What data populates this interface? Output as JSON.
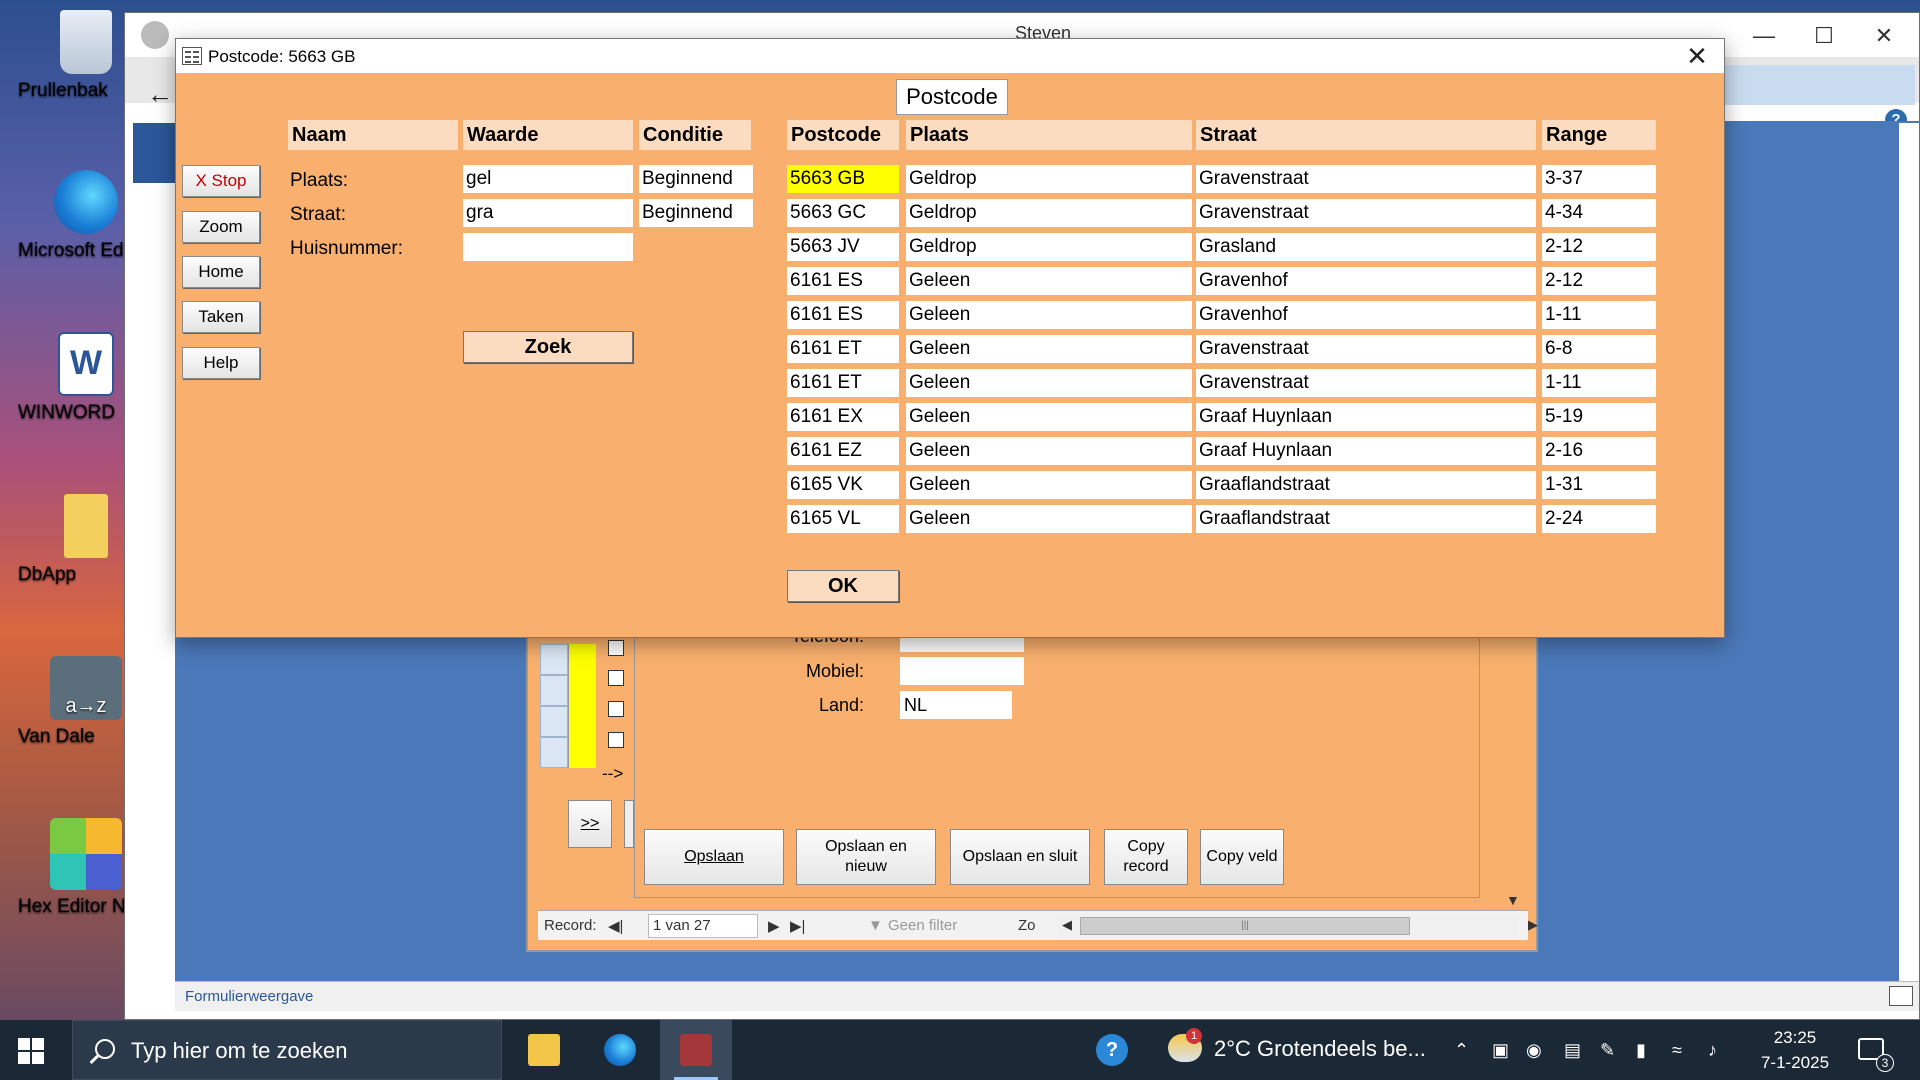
{
  "desktop": {
    "icons": [
      {
        "label": "Prullenbak"
      },
      {
        "label": "Microsoft Ed"
      },
      {
        "label": "WINWORD"
      },
      {
        "label": "DbApp"
      },
      {
        "label": "Van Dale"
      },
      {
        "label": "Hex Editor N"
      }
    ]
  },
  "access": {
    "title": "Steven",
    "status": "Formulierweergave",
    "bg_form": {
      "labels": {
        "telefoon": "Telefoon:",
        "mobiel": "Mobiel:",
        "land": "Land:"
      },
      "land_value": "NL",
      "arrow_text": "-->",
      "next_button": ">>",
      "buttons": {
        "opslaan": "Opslaan",
        "opslaan_nieuw": "Opslaan en nieuw",
        "opslaan_sluit": "Opslaan en sluit",
        "copy_record": "Copy record",
        "copy_veld": "Copy veld"
      }
    },
    "navbar": {
      "record_label": "Record:",
      "record_value": "1 van 27",
      "filter": "Geen filter",
      "search": "Zo"
    }
  },
  "dialog": {
    "title": "Postcode: 5663 GB",
    "side_buttons": {
      "stop": "X Stop",
      "zoom": "Zoom",
      "home": "Home",
      "taken": "Taken",
      "help": "Help"
    },
    "criteria": {
      "headers": {
        "naam": "Naam",
        "waarde": "Waarde",
        "conditie": "Conditie"
      },
      "rows": [
        {
          "label": "Plaats:",
          "value": "gel",
          "condition": "Beginnend"
        },
        {
          "label": "Straat:",
          "value": "gra",
          "condition": "Beginnend"
        },
        {
          "label": "Huisnummer:",
          "value": "",
          "condition": ""
        }
      ],
      "search_button": "Zoek"
    },
    "results": {
      "title": "Postcode",
      "headers": {
        "postcode": "Postcode",
        "plaats": "Plaats",
        "straat": "Straat",
        "range": "Range"
      },
      "rows": [
        {
          "postcode": "5663 GB",
          "plaats": "Geldrop",
          "straat": "Gravenstraat",
          "range": "3-37"
        },
        {
          "postcode": "5663 GC",
          "plaats": "Geldrop",
          "straat": "Gravenstraat",
          "range": "4-34"
        },
        {
          "postcode": "5663 JV",
          "plaats": "Geldrop",
          "straat": "Grasland",
          "range": "2-12"
        },
        {
          "postcode": "6161 ES",
          "plaats": "Geleen",
          "straat": "Gravenhof",
          "range": "2-12"
        },
        {
          "postcode": "6161 ES",
          "plaats": "Geleen",
          "straat": "Gravenhof",
          "range": "1-11"
        },
        {
          "postcode": "6161 ET",
          "plaats": "Geleen",
          "straat": "Gravenstraat",
          "range": "6-8"
        },
        {
          "postcode": "6161 ET",
          "plaats": "Geleen",
          "straat": "Gravenstraat",
          "range": "1-11"
        },
        {
          "postcode": "6161 EX",
          "plaats": "Geleen",
          "straat": "Graaf Huynlaan",
          "range": "5-19"
        },
        {
          "postcode": "6161 EZ",
          "plaats": "Geleen",
          "straat": "Graaf Huynlaan",
          "range": "2-16"
        },
        {
          "postcode": "6165 VK",
          "plaats": "Geleen",
          "straat": "Graaflandstraat",
          "range": "1-31"
        },
        {
          "postcode": "6165 VL",
          "plaats": "Geleen",
          "straat": "Graaflandstraat",
          "range": "2-24"
        }
      ],
      "ok_button": "OK"
    }
  },
  "taskbar": {
    "search_placeholder": "Typ hier om te zoeken",
    "weather": "2°C  Grotendeels be...",
    "weather_badge": "1",
    "time": "23:25",
    "date": "7-1-2025",
    "notification_count": "3"
  },
  "colors": {
    "dialog_bg": "#f9b06e",
    "header_bg": "#fcdcc0",
    "selected_cell": "#ffff00",
    "stop_text": "#c00000"
  }
}
